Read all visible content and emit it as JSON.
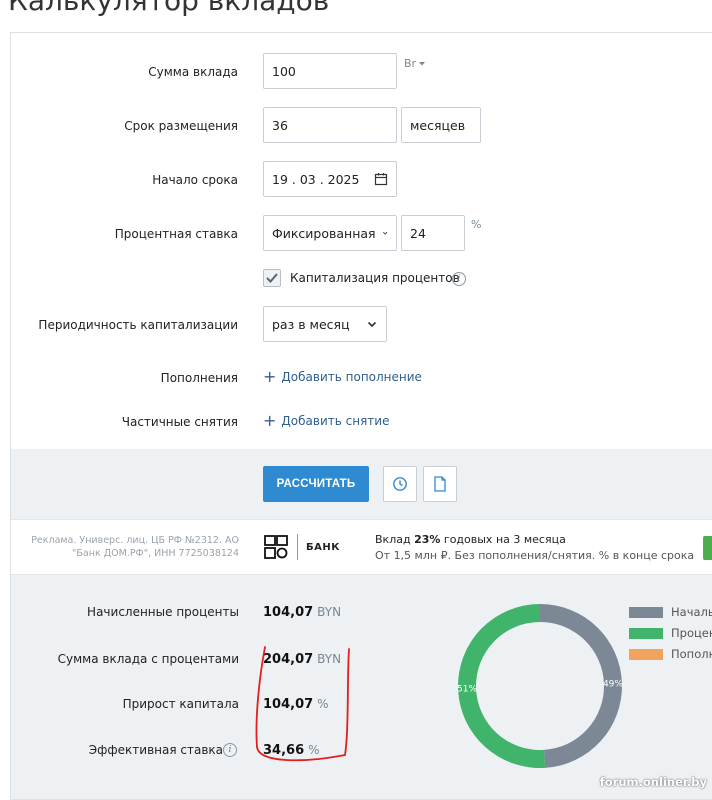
{
  "page": {
    "title": "Калькулятор вкладов"
  },
  "form": {
    "amount": {
      "label": "Сумма вклада",
      "value": "100",
      "currency": "Br"
    },
    "term": {
      "label": "Срок размещения",
      "value": "36",
      "unit_selected": "месяцев"
    },
    "start": {
      "label": "Начало срока",
      "value": "19 . 03 . 2025"
    },
    "rate": {
      "label": "Процентная ставка",
      "type_selected": "Фиксированная",
      "value": "24",
      "unit": "%"
    },
    "capitalization": {
      "label": "Капитализация процентов",
      "checked": true
    },
    "periodicity": {
      "label": "Периодичность капитализации",
      "selected": "раз в месяц"
    },
    "deposits": {
      "label": "Пополнения",
      "link": "Добавить пополнение"
    },
    "withdrawals": {
      "label": "Частичные снятия",
      "link": "Добавить снятие"
    }
  },
  "actions": {
    "calculate": "РАССЧИТАТЬ"
  },
  "ad": {
    "disclaimer": "Реклама. Универс. лиц. ЦБ РФ №2312. АО \"Банк ДОМ.РФ\", ИНН 7725038124",
    "bank_word": "БАНК",
    "line1_pre": "Вклад ",
    "line1_bold": "23%",
    "line1_post": " годовых на 3 месяца",
    "line2": "От 1,5 млн ₽. Без пополнения/снятия. % в конце срока"
  },
  "results": {
    "interest": {
      "label": "Начисленные проценты",
      "value": "104,07",
      "unit": "BYN"
    },
    "total": {
      "label": "Сумма вклада с процентами",
      "value": "204,07",
      "unit": "BYN"
    },
    "growth": {
      "label": "Прирост капитала",
      "value": "104,07",
      "unit": "%"
    },
    "effective": {
      "label": "Эффективная ставка",
      "value": "34,66",
      "unit": "%"
    }
  },
  "chart_data": {
    "type": "pie",
    "variant": "donut",
    "slices": [
      {
        "name": "Начальная",
        "value": 49,
        "label": "49%",
        "color": "#7d8896"
      },
      {
        "name": "Проценты",
        "value": 51,
        "label": "51%",
        "color": "#41b46b"
      },
      {
        "name": "Пополнения",
        "value": 0,
        "label": "",
        "color": "#f2a35e"
      }
    ],
    "legend_position": "right"
  },
  "legend": [
    "Началь",
    "Процен",
    "Пополн"
  ],
  "watermark": "forum.onliner.by",
  "colors": {
    "accent": "#2f8bd1",
    "link": "#2f5f8f",
    "band": "#eef1f4",
    "annotation": "#e0201e"
  }
}
